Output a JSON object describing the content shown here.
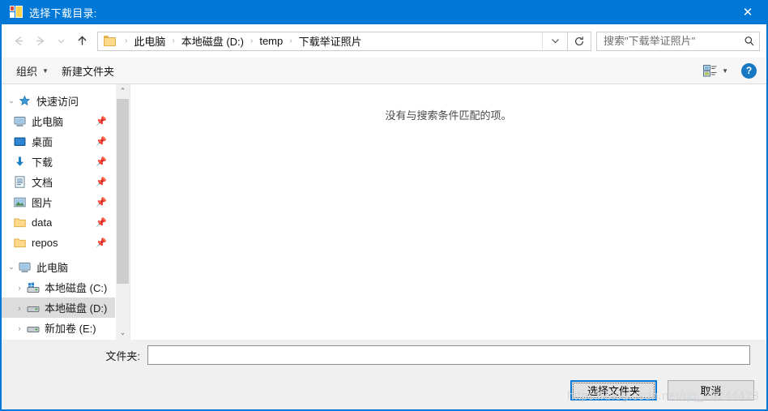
{
  "window": {
    "title": "选择下载目录:",
    "icon": "folder-window-icon",
    "close_label": "✕",
    "accent_color": "#0078d7"
  },
  "nav": {
    "back_icon": "back-arrow-icon",
    "forward_icon": "forward-arrow-icon",
    "recent_icon": "recent-locations-chevron-icon",
    "up_icon": "up-arrow-icon",
    "refresh_icon": "refresh-icon",
    "dropdown_icon": "chevron-down-icon",
    "breadcrumb": [
      "此电脑",
      "本地磁盘 (D:)",
      "temp",
      "下载举证照片"
    ],
    "separator": "›"
  },
  "search": {
    "placeholder": "搜索\"下载举证照片\"",
    "value": "",
    "icon": "search-icon"
  },
  "commandbar": {
    "organize_label": "组织",
    "new_folder_label": "新建文件夹",
    "view_icon": "view-layout-icon",
    "view_caret": "▼",
    "help_label": "?"
  },
  "tree": {
    "groups": [
      {
        "label": "快速访问",
        "icon": "star-pin-icon",
        "expander": "⌄",
        "items": [
          {
            "label": "此电脑",
            "icon": "computer-icon",
            "pinned": "📌"
          },
          {
            "label": "桌面",
            "icon": "desktop-icon",
            "pinned": "📌"
          },
          {
            "label": "下载",
            "icon": "download-icon",
            "pinned": "📌"
          },
          {
            "label": "文档",
            "icon": "documents-icon",
            "pinned": "📌"
          },
          {
            "label": "图片",
            "icon": "pictures-icon",
            "pinned": "📌"
          },
          {
            "label": "data",
            "icon": "folder-icon",
            "pinned": "📌"
          },
          {
            "label": "repos",
            "icon": "folder-icon",
            "pinned": "📌"
          }
        ]
      },
      {
        "label": "此电脑",
        "icon": "computer-icon",
        "expander": "⌄",
        "items": [
          {
            "label": "本地磁盘 (C:)",
            "icon": "windows-drive-icon",
            "expander": "›",
            "selected": false
          },
          {
            "label": "本地磁盘 (D:)",
            "icon": "drive-icon",
            "expander": "›",
            "selected": true
          },
          {
            "label": "新加卷 (E:)",
            "icon": "drive-icon",
            "expander": "›",
            "selected": false
          }
        ]
      }
    ],
    "scroll_up": "⌃",
    "scroll_down": "⌄"
  },
  "filelist": {
    "empty_message": "没有与搜索条件匹配的项。"
  },
  "footer": {
    "folder_label": "文件夹:",
    "folder_value": "",
    "select_button": "选择文件夹",
    "cancel_button": "取消"
  },
  "watermark": {
    "text": "https://blog.csdn.net/qq_26244423"
  }
}
